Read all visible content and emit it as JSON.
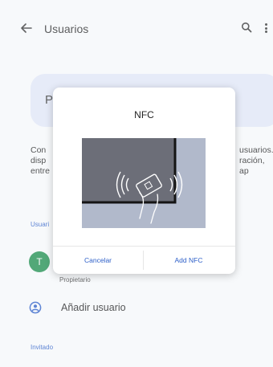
{
  "app_bar": {
    "title": "Usuarios",
    "back_icon": "arrow-back-icon",
    "search_icon": "search-icon",
    "more_icon": "more-vert-icon"
  },
  "background": {
    "profile_card_initial": "P",
    "description_left": [
      "Con",
      "disp",
      "entre"
    ],
    "description_right": [
      "usuarios.",
      "ración, ap"
    ],
    "section_users_label": "Usuari",
    "user": {
      "avatar_letter": "T",
      "avatar_color": "#1e8f4e",
      "role": "Propietario"
    },
    "add_user_label": "Añadir usuario",
    "section_guest_label": "Invitado"
  },
  "dialog": {
    "title": "NFC",
    "illustration": "nfc-tap-card-illustration",
    "cancel_label": "Cancelar",
    "add_label": "Add NFC"
  },
  "colors": {
    "accent": "#2d5fc8",
    "card_bg": "#e3e9f8",
    "avatar": "#1e8f4e"
  }
}
